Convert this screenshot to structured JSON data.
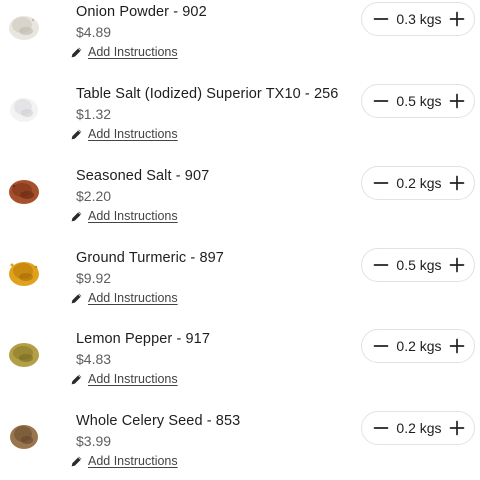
{
  "cart": {
    "items": [
      {
        "title": "Onion Powder - 902",
        "price": "$4.89",
        "instructions_label": "Add Instructions",
        "quantity": "0.3 kgs",
        "thumb_icon": "onion-powder-pile-icon",
        "colors": {
          "base": "#e9e6df",
          "mid": "#d8d4cb",
          "dark": "#bfb9ae"
        }
      },
      {
        "title": "Table Salt (Iodized) Superior TX10 - 256",
        "price": "$1.32",
        "instructions_label": "Add Instructions",
        "quantity": "0.5 kgs",
        "thumb_icon": "salt-pile-icon",
        "colors": {
          "base": "#f3f3f3",
          "mid": "#e4e4e6",
          "dark": "#cfcfd3"
        }
      },
      {
        "title": "Seasoned Salt - 907",
        "price": "$2.20",
        "instructions_label": "Add Instructions",
        "quantity": "0.2 kgs",
        "thumb_icon": "seasoned-salt-pile-icon",
        "colors": {
          "base": "#a6502c",
          "mid": "#8e3f20",
          "dark": "#6e2e16"
        }
      },
      {
        "title": "Ground Turmeric - 897",
        "price": "$9.92",
        "instructions_label": "Add Instructions",
        "quantity": "0.5 kgs",
        "thumb_icon": "turmeric-pile-icon",
        "colors": {
          "base": "#e0a21c",
          "mid": "#c98a10",
          "dark": "#a66c06"
        }
      },
      {
        "title": "Lemon Pepper - 917",
        "price": "$4.83",
        "instructions_label": "Add Instructions",
        "quantity": "0.2 kgs",
        "thumb_icon": "lemon-pepper-pile-icon",
        "colors": {
          "base": "#b3a046",
          "mid": "#9a8833",
          "dark": "#7a6a24"
        }
      },
      {
        "title": "Whole Celery Seed - 853",
        "price": "$3.99",
        "instructions_label": "Add Instructions",
        "quantity": "0.2 kgs",
        "thumb_icon": "celery-seed-pile-icon",
        "colors": {
          "base": "#9a7650",
          "mid": "#7f5e3c",
          "dark": "#62462b"
        }
      }
    ]
  }
}
